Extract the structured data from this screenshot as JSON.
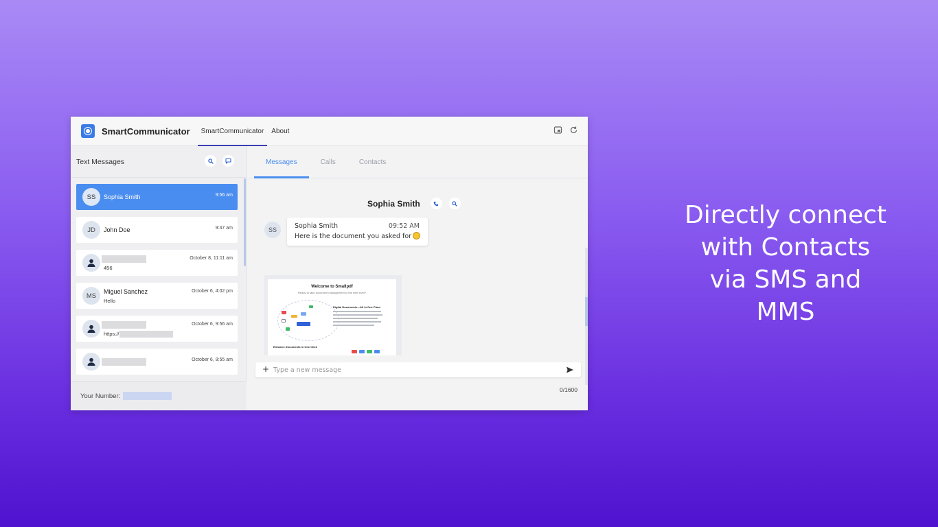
{
  "app": {
    "title": "SmartCommunicator",
    "nav_tabs": [
      "SmartCommunicator",
      "About"
    ],
    "accent_color": "#4a8df0",
    "header_icons": [
      "pip-icon",
      "refresh-icon"
    ]
  },
  "sidebar": {
    "title": "Text Messages",
    "conversations": [
      {
        "initials": "SS",
        "name": "Sophia Smith",
        "preview": "",
        "time": "9:56 am",
        "selected": true
      },
      {
        "initials": "JD",
        "name": "John Doe",
        "preview": "",
        "time": "9:47 am",
        "selected": false
      },
      {
        "initials": "",
        "name": "",
        "preview": "456",
        "time": "October 8, 11:11 am",
        "selected": false
      },
      {
        "initials": "MS",
        "name": "Miguel Sanchez",
        "preview": "Hello",
        "time": "October 6, 4:02 pm",
        "selected": false
      },
      {
        "initials": "",
        "name": "",
        "preview": "https://",
        "time": "October 6, 9:56 am",
        "selected": false
      },
      {
        "initials": "",
        "name": "",
        "preview": "",
        "time": "October 6, 9:55 am",
        "selected": false
      }
    ],
    "footer_label": "Your Number:"
  },
  "main": {
    "tabs": [
      "Messages",
      "Calls",
      "Contacts"
    ],
    "active_tab": "Messages",
    "chat_name": "Sophia Smith",
    "message": {
      "avatar_initials": "SS",
      "sender": "Sophia Smith",
      "time": "09:52 AM",
      "text": "Here is the document you asked for"
    },
    "attachment": {
      "title": "Welcome to Smallpdf",
      "subtitle": "Ready to take document management to the next level?",
      "section_heading": "Digital Documents—All In One Place",
      "footer_heading": "Enhance Documents in One Click"
    },
    "composer": {
      "placeholder": "Type a new message",
      "counter": "0/1600"
    }
  },
  "caption": {
    "lines": [
      "Directly connect",
      "with Contacts",
      "via SMS and",
      "MMS"
    ]
  }
}
